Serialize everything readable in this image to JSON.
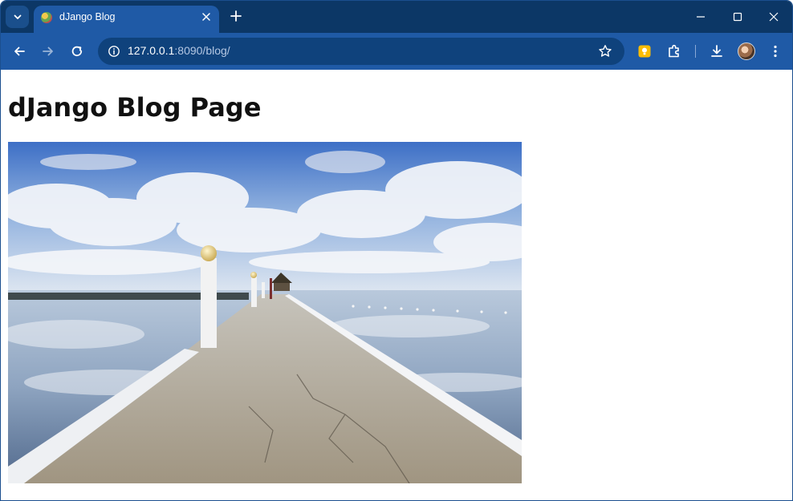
{
  "browser": {
    "tab": {
      "title": "dJango Blog"
    },
    "address": {
      "host": "127.0.0.1",
      "rest": ":8090/blog/"
    }
  },
  "page": {
    "heading": "dJango Blog Page"
  },
  "icons": {
    "tab_search": "chevron-down-icon",
    "favicon": "django-favicon-icon",
    "tab_close": "close-icon",
    "new_tab": "plus-icon",
    "minimize": "minimize-icon",
    "maximize": "maximize-icon",
    "close_window": "close-icon",
    "back": "arrow-left-icon",
    "forward": "arrow-right-icon",
    "reload": "reload-icon",
    "site_info": "info-icon",
    "bookmark": "star-icon",
    "keep": "keep-extension-icon",
    "extensions": "puzzle-icon",
    "downloads": "download-icon",
    "profile": "avatar",
    "menu": "kebab-menu-icon"
  },
  "colors": {
    "tab_strip": "#0c3766",
    "toolbar": "#1f5aa6",
    "omnibox": "#0f427c",
    "page_background": "#ffffff"
  }
}
